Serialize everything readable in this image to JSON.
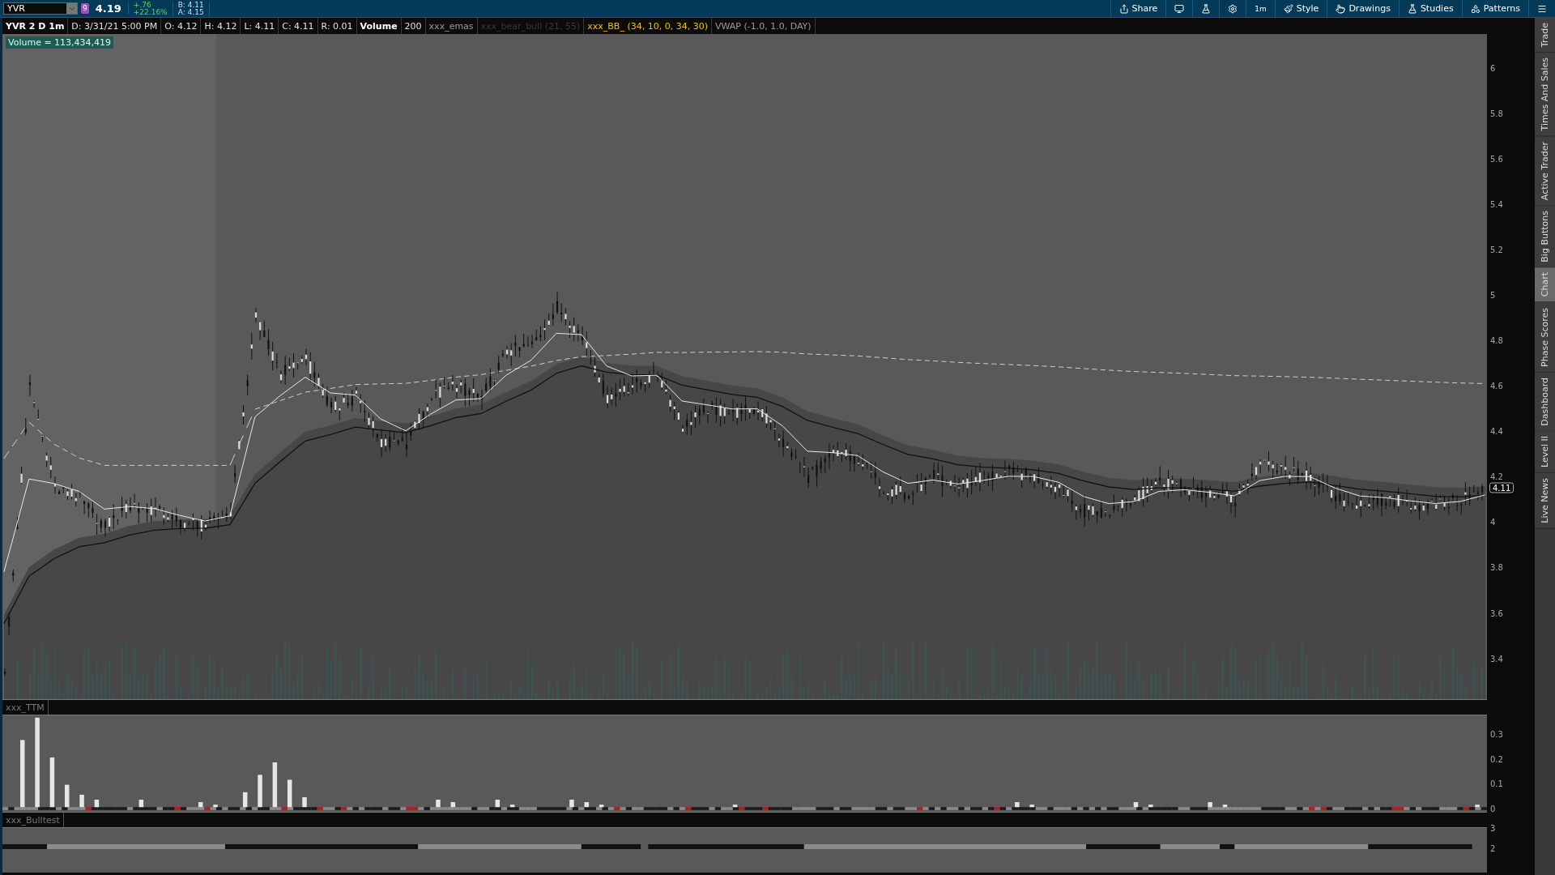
{
  "toolbar": {
    "symbol": "YVR",
    "badge": "9",
    "last": "4.19",
    "change": "+.76",
    "change_pct": "+22.16%",
    "bid": "B: 4.11",
    "ask": "A: 4.15",
    "buttons": [
      {
        "kind": "share",
        "label": "Share"
      },
      {
        "kind": "monitor"
      },
      {
        "kind": "flask"
      },
      {
        "kind": "gear"
      },
      {
        "kind": "text",
        "label": "1m"
      },
      {
        "kind": "style",
        "label": "Style"
      },
      {
        "kind": "drawings",
        "label": "Drawings"
      },
      {
        "kind": "studies",
        "label": "Studies"
      },
      {
        "kind": "patterns",
        "label": "Patterns"
      },
      {
        "kind": "menu"
      }
    ]
  },
  "study_bar": [
    {
      "kind": "title",
      "text": "YVR 2 D 1m"
    },
    {
      "kind": "info",
      "text": "D: 3/31/21 5:00 PM"
    },
    {
      "kind": "info",
      "text": "O: 4.12"
    },
    {
      "kind": "info",
      "text": "H: 4.12"
    },
    {
      "kind": "info",
      "text": "L: 4.11"
    },
    {
      "kind": "info",
      "text": "C: 4.11"
    },
    {
      "kind": "info",
      "text": "R: 0.01"
    },
    {
      "kind": "title",
      "text": "Volume"
    },
    {
      "kind": "info",
      "text": "200"
    },
    {
      "kind": "study",
      "text": "xxx_emas"
    },
    {
      "kind": "inactive",
      "text": "xxx_bear_bull (21, 55)"
    },
    {
      "kind": "highlight",
      "text": "xxx_BB_ (34, 10, 0, 34, 30)"
    },
    {
      "kind": "study",
      "text": "VWAP (-1.0, 1.0, DAY)"
    }
  ],
  "price_chart": {
    "volume_label": "Volume = 113,434,419",
    "last_price_tag": "4.11",
    "yticks": [
      "6",
      "5.8",
      "5.6",
      "5.4",
      "5.2",
      "5",
      "4.8",
      "4.6",
      "4.4",
      "4.2",
      "4",
      "3.8",
      "3.6",
      "3.4"
    ]
  },
  "ttm": {
    "title": "xxx_TTM",
    "yticks": [
      "0.3",
      "0.2",
      "0.1",
      "0"
    ]
  },
  "bulltest": {
    "title": "xxx_Bulltest",
    "yticks": [
      "3",
      "2"
    ]
  },
  "side_tabs": [
    {
      "label": "Trade",
      "selected": false
    },
    {
      "label": "Times And Sales",
      "selected": false
    },
    {
      "label": "Active Trader",
      "selected": false
    },
    {
      "label": "Big Buttons",
      "selected": false
    },
    {
      "label": "Chart",
      "selected": true
    },
    {
      "label": "Phase Scores",
      "selected": false
    },
    {
      "label": "Dashboard",
      "selected": false
    },
    {
      "label": "Level II",
      "selected": false
    },
    {
      "label": "Live News",
      "selected": false
    }
  ]
}
